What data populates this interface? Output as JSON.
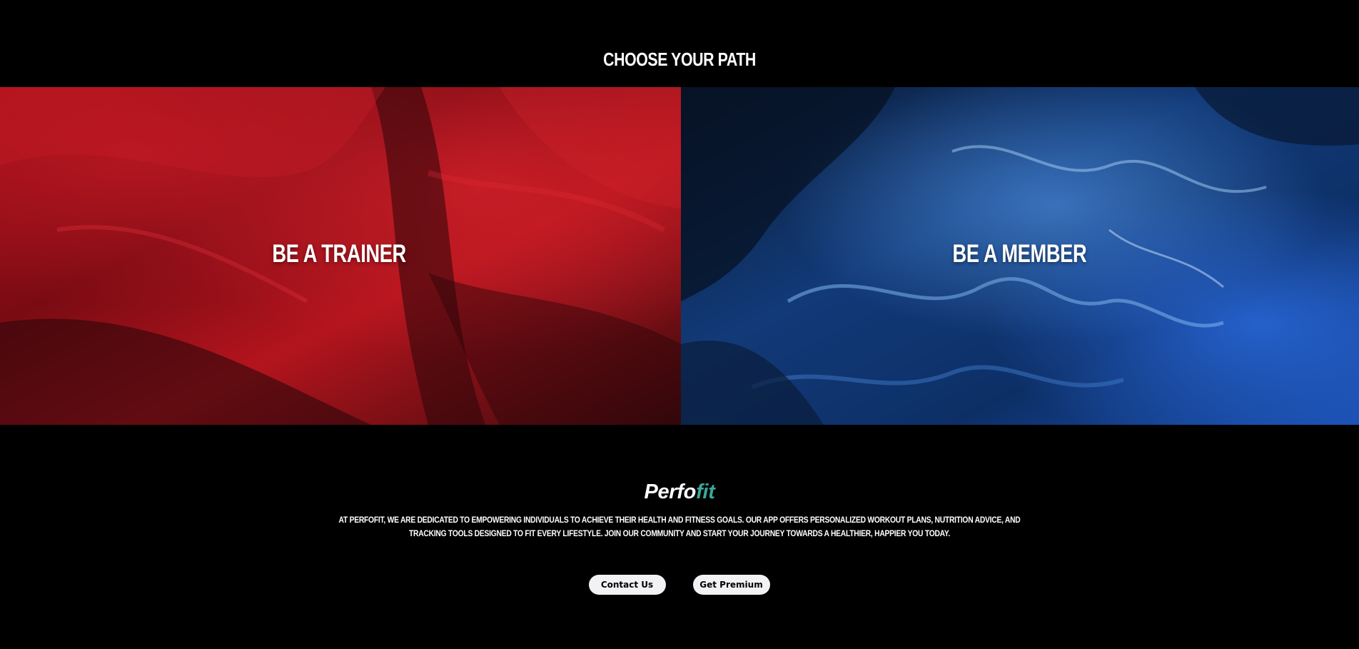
{
  "section": {
    "title": "CHOOSE YOUR PATH"
  },
  "paths": [
    {
      "label": "BE A TRAINER",
      "accent": "#b5121b"
    },
    {
      "label": "BE A MEMBER",
      "accent": "#1f4f9c"
    }
  ],
  "footer": {
    "logo_part1": "Perfo",
    "logo_part2": "fit",
    "logo_accent": "#3aa89a",
    "description": "At PerfoFit, we are dedicated to empowering individuals to achieve their health and fitness goals. Our app offers personalized workout plans, nutrition advice, and tracking tools designed to fit every lifestyle. Join our community and start your journey towards a healthier, happier you today."
  },
  "actions": {
    "contact_label": "Contact Us",
    "premium_label": "Get Premium"
  }
}
